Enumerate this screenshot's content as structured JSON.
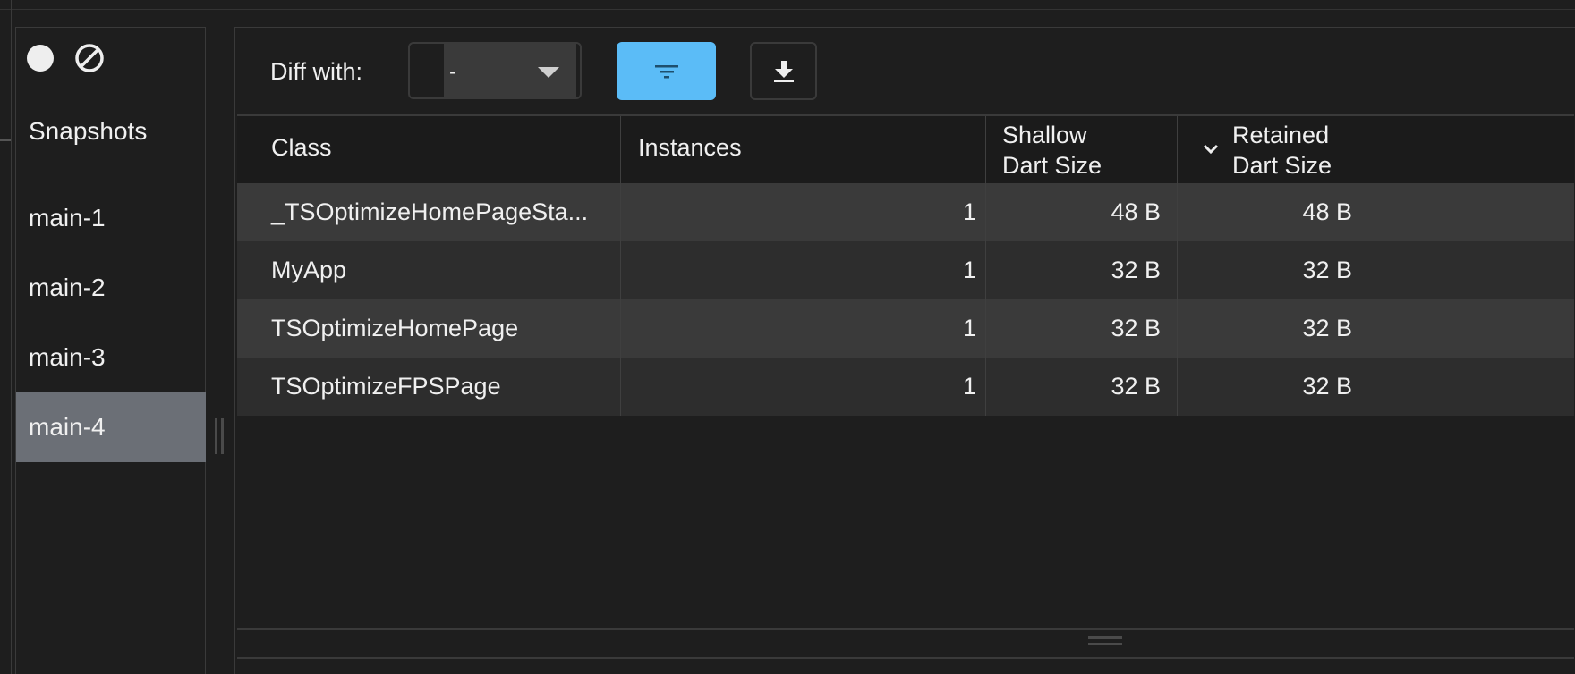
{
  "sidebar": {
    "title": "Snapshots",
    "items": [
      {
        "label": "main-1",
        "selected": false
      },
      {
        "label": "main-2",
        "selected": false
      },
      {
        "label": "main-3",
        "selected": false
      },
      {
        "label": "main-4",
        "selected": true
      }
    ],
    "controls": {
      "record_icon": "record-icon",
      "clear_icon": "clear-icon"
    }
  },
  "toolbar": {
    "diff_label": "Diff with:",
    "diff_value": "-",
    "filter_icon": "filter-icon",
    "download_icon": "download-icon",
    "filter_color": "#5bbcf7"
  },
  "table": {
    "columns": [
      {
        "label": "Class"
      },
      {
        "label": "Instances"
      },
      {
        "line1": "Shallow",
        "line2": "Dart Size"
      },
      {
        "line1": "Retained",
        "line2": "Dart Size",
        "sorted": "descending"
      }
    ],
    "rows": [
      {
        "class": "_TSOptimizeHomePageSta...",
        "instances": "1",
        "shallow": "48  B",
        "retained": "48  B"
      },
      {
        "class": "MyApp",
        "instances": "1",
        "shallow": "32  B",
        "retained": "32  B"
      },
      {
        "class": "TSOptimizeHomePage",
        "instances": "1",
        "shallow": "32  B",
        "retained": "32  B"
      },
      {
        "class": "TSOptimizeFPSPage",
        "instances": "1",
        "shallow": "32  B",
        "retained": "32  B"
      }
    ]
  }
}
